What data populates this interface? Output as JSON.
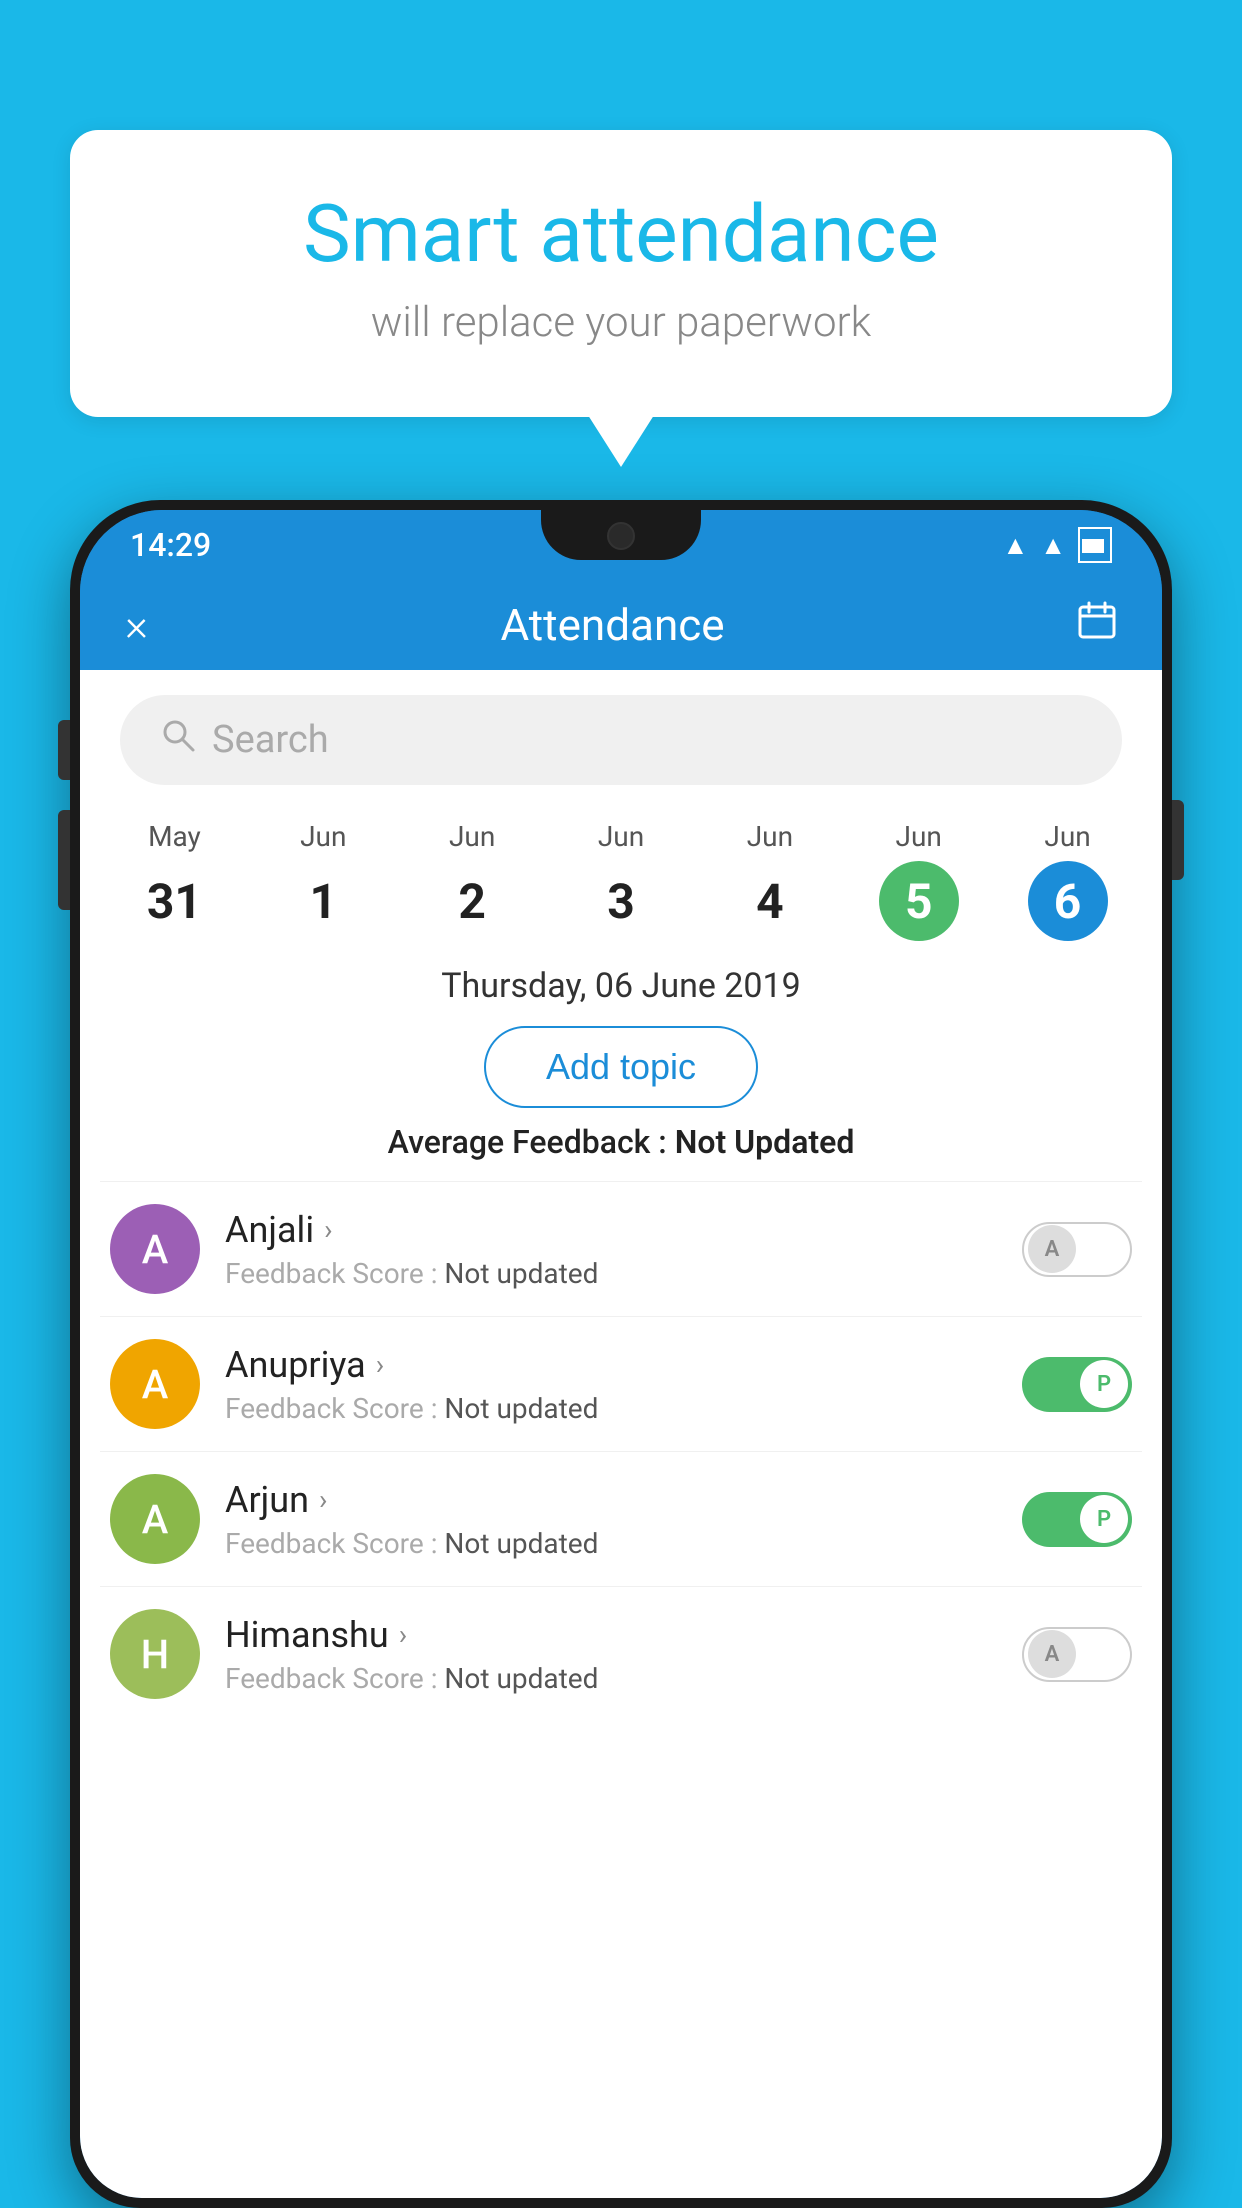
{
  "background_color": "#1ab8e8",
  "bubble": {
    "title": "Smart attendance",
    "subtitle": "will replace your paperwork"
  },
  "status_bar": {
    "time": "14:29",
    "icons": [
      "wifi",
      "signal",
      "battery"
    ]
  },
  "app_header": {
    "close_label": "×",
    "title": "Attendance",
    "calendar_icon": "📅"
  },
  "search": {
    "placeholder": "Search"
  },
  "calendar": {
    "days": [
      {
        "month": "May",
        "num": "31",
        "state": "normal"
      },
      {
        "month": "Jun",
        "num": "1",
        "state": "normal"
      },
      {
        "month": "Jun",
        "num": "2",
        "state": "normal"
      },
      {
        "month": "Jun",
        "num": "3",
        "state": "normal"
      },
      {
        "month": "Jun",
        "num": "4",
        "state": "normal"
      },
      {
        "month": "Jun",
        "num": "5",
        "state": "today"
      },
      {
        "month": "Jun",
        "num": "6",
        "state": "selected"
      }
    ]
  },
  "selected_date": "Thursday, 06 June 2019",
  "add_topic_label": "Add topic",
  "avg_feedback_prefix": "Average Feedback : ",
  "avg_feedback_value": "Not Updated",
  "students": [
    {
      "name": "Anjali",
      "avatar_letter": "A",
      "avatar_color": "#9c5fb5",
      "feedback_label": "Feedback Score : ",
      "feedback_value": "Not updated",
      "toggle_state": "off",
      "toggle_letter": "A"
    },
    {
      "name": "Anupriya",
      "avatar_letter": "A",
      "avatar_color": "#f0a500",
      "feedback_label": "Feedback Score : ",
      "feedback_value": "Not updated",
      "toggle_state": "on",
      "toggle_letter": "P"
    },
    {
      "name": "Arjun",
      "avatar_letter": "A",
      "avatar_color": "#8ab84a",
      "feedback_label": "Feedback Score : ",
      "feedback_value": "Not updated",
      "toggle_state": "on",
      "toggle_letter": "P"
    },
    {
      "name": "Himanshu",
      "avatar_letter": "H",
      "avatar_color": "#9cbe5a",
      "feedback_label": "Feedback Score : ",
      "feedback_value": "Not updated",
      "toggle_state": "off",
      "toggle_letter": "A"
    }
  ]
}
